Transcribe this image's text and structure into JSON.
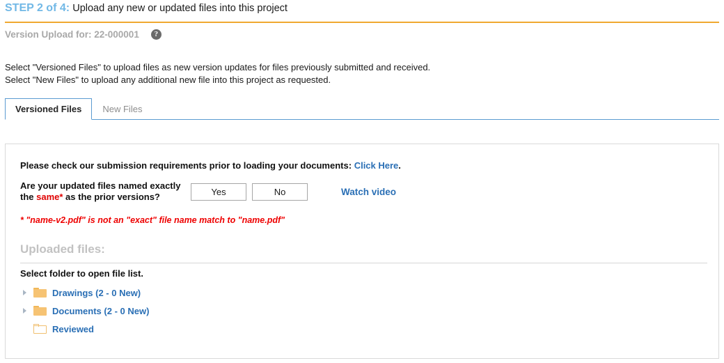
{
  "header": {
    "step_label": "STEP 2 of 4:",
    "step_description": "Upload any new or updated files into this project",
    "version_text": "Version Upload for: 22-000001",
    "help_icon_glyph": "?",
    "accent_rule_color": "#f0a830",
    "step_label_color": "#71b8e6"
  },
  "intro": {
    "line1": "Select \"Versioned Files\" to upload files as new version updates for files previously submitted and received.",
    "line2": "Select \"New Files\" to upload any additional new file into this project as requested."
  },
  "tabs": {
    "items": [
      {
        "label": "Versioned Files",
        "active": true
      },
      {
        "label": "New Files",
        "active": false
      }
    ],
    "active_border_color": "#5b9bd1"
  },
  "panel": {
    "requirements": {
      "text": "Please check our submission requirements prior to loading your documents:",
      "link_label": "Click Here",
      "trailing_punctuation": "."
    },
    "question": {
      "line1_before": "Are your updated files named exactly",
      "line2_before": "the ",
      "line2_highlight": "same*",
      "line2_after": " as the prior versions?",
      "yes_label": "Yes",
      "no_label": "No",
      "watch_video_label": "Watch video",
      "highlight_color": "#e00000"
    },
    "note": "* \"name-v2.pdf\" is not an \"exact\" file name match to \"name.pdf\"",
    "note_color": "#ee0000",
    "uploaded_heading": "Uploaded files:",
    "select_folder_text": "Select folder to open file list.",
    "folders": [
      {
        "label": "Drawings (2 - 0 New)",
        "expandable": true,
        "filled": true
      },
      {
        "label": "Documents (2 - 0 New)",
        "expandable": true,
        "filled": true
      },
      {
        "label": "Reviewed",
        "expandable": false,
        "filled": false
      }
    ],
    "folder_link_color": "#2a6fb5"
  }
}
